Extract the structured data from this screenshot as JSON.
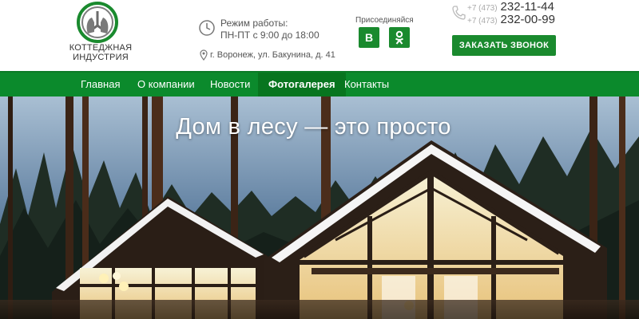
{
  "brand": {
    "name_line1": "Коттеджная",
    "name_line2": "индустрия",
    "logo_color": "#1a8a2e"
  },
  "contacts": {
    "hours_title": "Режим работы:",
    "hours_value": "ПН-ПТ с 9:00 до 18:00",
    "address": "г. Воронеж, ул. Бакунина, д. 41",
    "phones": [
      {
        "code": "+7 (473)",
        "number": "232-11-44"
      },
      {
        "code": "+7 (473)",
        "number": "232-00-99"
      }
    ],
    "callback_label": "ЗАКАЗАТЬ ЗВОНОК"
  },
  "social": {
    "title": "Присоединяйся",
    "vk_label": "B",
    "ok_label": "ok"
  },
  "nav": {
    "items": [
      {
        "label": "Главная"
      },
      {
        "label": "О компании"
      },
      {
        "label": "Новости"
      },
      {
        "label": "Фотогалерея",
        "active": true
      },
      {
        "label": "Контакты"
      }
    ]
  },
  "hero": {
    "title": "Дом в лесу — это просто"
  },
  "colors": {
    "accent": "#1a8a2e",
    "nav_bg": "#0b8a2c",
    "nav_active": "#08751f"
  }
}
